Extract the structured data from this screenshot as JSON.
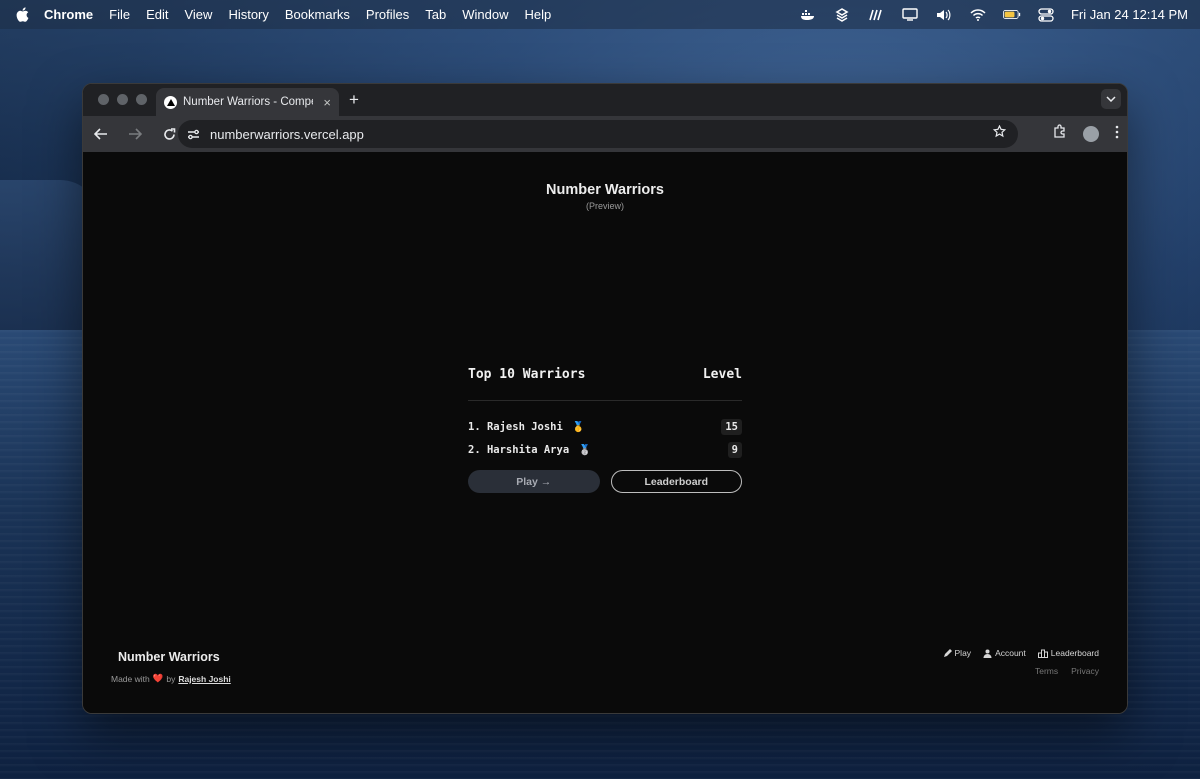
{
  "menubar": {
    "app_name": "Chrome",
    "items": [
      "File",
      "Edit",
      "View",
      "History",
      "Bookmarks",
      "Profiles",
      "Tab",
      "Window",
      "Help"
    ],
    "clock": "Fri Jan 24  12:14 PM"
  },
  "browser": {
    "tab_title": "Number Warriors - Compete,",
    "tab_close": "×",
    "new_tab": "+",
    "url": "numberwarriors.vercel.app"
  },
  "page": {
    "title": "Number Warriors",
    "subtitle": "(Preview)",
    "leaderboard": {
      "heading": "Top 10 Warriors",
      "level_heading": "Level",
      "rows": [
        {
          "rank_name": "1. Rajesh Joshi",
          "medal": "🥇",
          "level": "15"
        },
        {
          "rank_name": "2. Harshita Arya",
          "medal": "🥈",
          "level": "9"
        }
      ]
    },
    "play_button": "Play →",
    "leaderboard_button": "Leaderboard"
  },
  "footer": {
    "title": "Number Warriors",
    "made_with": "Made with",
    "heart": "❤️",
    "by": "by",
    "author": "Rajesh Joshi",
    "links": [
      "Play",
      "Account",
      "Leaderboard"
    ],
    "legal": [
      "Terms",
      "Privacy"
    ]
  }
}
